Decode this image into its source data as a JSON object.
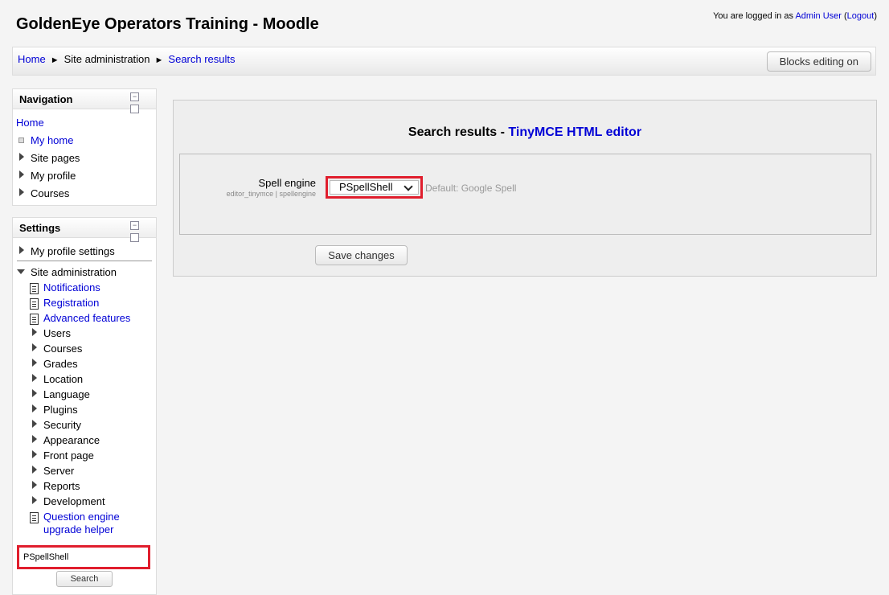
{
  "header": {
    "site_title": "GoldenEye Operators Training - Moodle",
    "login_prefix": "You are logged in as ",
    "user_name": "Admin User",
    "logout_label": "Logout"
  },
  "breadcrumb": {
    "home": "Home",
    "site_admin": "Site administration",
    "search_results": "Search results",
    "separator": "►"
  },
  "toolbar": {
    "blocks_editing": "Blocks editing on"
  },
  "navigation": {
    "title": "Navigation",
    "home": "Home",
    "items": [
      "My home",
      "Site pages",
      "My profile",
      "Courses"
    ]
  },
  "settings": {
    "title": "Settings",
    "my_profile_settings": "My profile settings",
    "site_admin": "Site administration",
    "page_links": [
      "Notifications",
      "Registration",
      "Advanced features"
    ],
    "categories": [
      "Users",
      "Courses",
      "Grades",
      "Location",
      "Language",
      "Plugins",
      "Security",
      "Appearance",
      "Front page",
      "Server",
      "Reports",
      "Development"
    ],
    "question_engine_line1": "Question engine",
    "question_engine_line2": "upgrade helper",
    "search_value": "PSpellShell",
    "search_button": "Search"
  },
  "main": {
    "heading_prefix": "Search results - ",
    "heading_link": "TinyMCE HTML editor",
    "setting_label": "Spell engine",
    "setting_sub": "editor_tinymce | spellengine",
    "selected_value": "PSpellShell",
    "default_text": "Default: Google Spell",
    "save_button": "Save changes"
  }
}
